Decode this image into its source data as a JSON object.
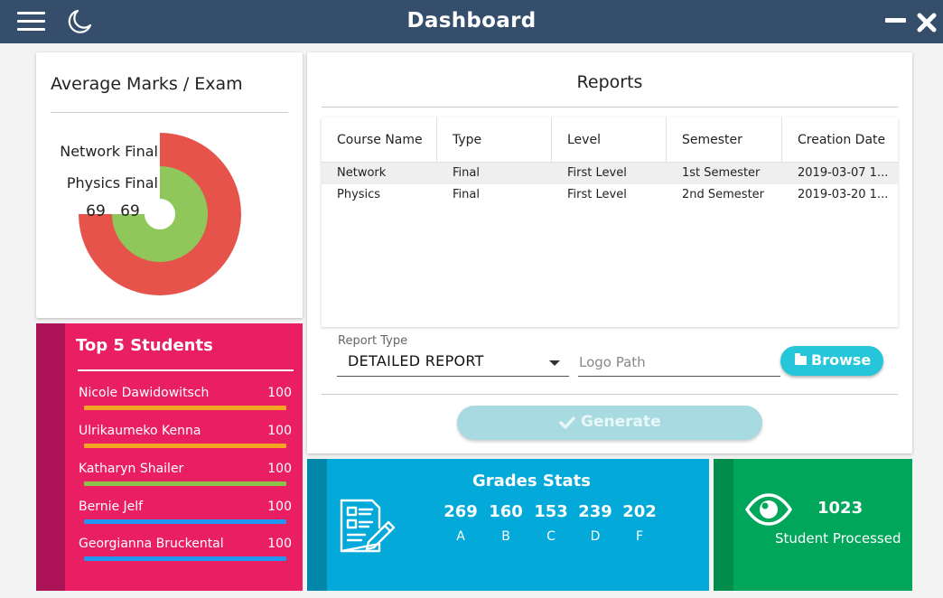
{
  "window": {
    "title": "Dashboard"
  },
  "average_marks": {
    "title": "Average Marks / Exam",
    "chart_data": {
      "type": "pie",
      "subtype": "concentric-donut",
      "series": [
        {
          "name": "Network Final",
          "value": 69,
          "color": "#e5534b"
        },
        {
          "name": "Physics Final",
          "value": 69,
          "color": "#8fc75b"
        }
      ]
    }
  },
  "top_students": {
    "title": "Top 5 Students",
    "items": [
      {
        "name": "Nicole Dawidowitsch",
        "score": "100",
        "color": "#f5a623"
      },
      {
        "name": "Ulrikaumeko Kenna",
        "score": "100",
        "color": "#f5a623"
      },
      {
        "name": "Katharyn Shailer",
        "score": "100",
        "color": "#8bc34a"
      },
      {
        "name": "Bernie Jelf",
        "score": "100",
        "color": "#2196f3"
      },
      {
        "name": "Georgianna Bruckental",
        "score": "100",
        "color": "#2196f3"
      }
    ]
  },
  "reports": {
    "title": "Reports",
    "columns": [
      "Course Name",
      "Type",
      "Level",
      "Semester",
      "Creation Date"
    ],
    "rows": [
      [
        "Network",
        "Final",
        "First Level",
        "1st Semester",
        "2019-03-07 1..."
      ],
      [
        "Physics",
        "Final",
        "First Level",
        "2nd Semester",
        "2019-03-20 1..."
      ]
    ],
    "report_type_label": "Report Type",
    "report_type_value": "DETAILED REPORT",
    "logo_placeholder": "Logo Path",
    "browse_label": "Browse",
    "generate_label": "Generate"
  },
  "grades": {
    "title": "Grades Stats",
    "stats": [
      {
        "value": "269",
        "letter": "A"
      },
      {
        "value": "160",
        "letter": "B"
      },
      {
        "value": "153",
        "letter": "C"
      },
      {
        "value": "239",
        "letter": "D"
      },
      {
        "value": "202",
        "letter": "F"
      }
    ]
  },
  "processed": {
    "count": "1023",
    "label": "Student Processed"
  },
  "colors": {
    "titlebar": "#354e6b",
    "top_students": "#e91e63",
    "grades": "#03a9d9",
    "processed": "#00a65a",
    "accent": "#26c6da"
  }
}
